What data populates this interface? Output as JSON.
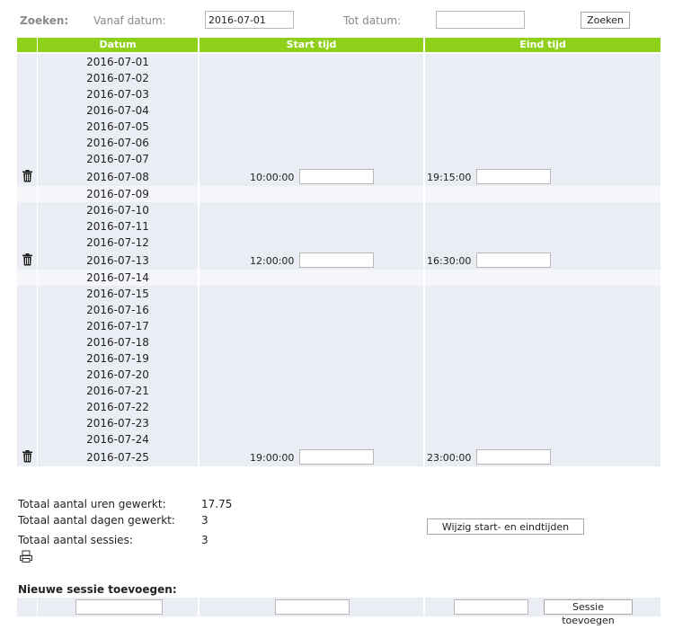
{
  "search": {
    "label": "Zoeken:",
    "from_label": "Vanaf datum:",
    "from_value": "2016-07-01",
    "to_label": "Tot datum:",
    "to_value": "",
    "button": "Zoeken"
  },
  "table": {
    "headers": [
      "Datum",
      "Start tijd",
      "Eind tijd"
    ],
    "rows": [
      {
        "date": "2016-07-01"
      },
      {
        "date": "2016-07-02"
      },
      {
        "date": "2016-07-03"
      },
      {
        "date": "2016-07-04"
      },
      {
        "date": "2016-07-05"
      },
      {
        "date": "2016-07-06"
      },
      {
        "date": "2016-07-07"
      },
      {
        "date": "2016-07-08",
        "start": "10:00:00",
        "end": "19:15:00",
        "session": true
      },
      {
        "date": "2016-07-09"
      },
      {
        "date": "2016-07-10"
      },
      {
        "date": "2016-07-11"
      },
      {
        "date": "2016-07-12"
      },
      {
        "date": "2016-07-13",
        "start": "12:00:00",
        "end": "16:30:00",
        "session": true
      },
      {
        "date": "2016-07-14"
      },
      {
        "date": "2016-07-15"
      },
      {
        "date": "2016-07-16"
      },
      {
        "date": "2016-07-17"
      },
      {
        "date": "2016-07-18"
      },
      {
        "date": "2016-07-19"
      },
      {
        "date": "2016-07-20"
      },
      {
        "date": "2016-07-21"
      },
      {
        "date": "2016-07-22"
      },
      {
        "date": "2016-07-23"
      },
      {
        "date": "2016-07-24"
      },
      {
        "date": "2016-07-25",
        "start": "19:00:00",
        "end": "23:00:00",
        "session": true
      }
    ]
  },
  "summary": {
    "hours_label": "Totaal aantal uren gewerkt:",
    "hours_value": "17.75",
    "days_label": "Totaal aantal dagen gewerkt:",
    "days_value": "3",
    "sessions_label": "Totaal aantal sessies:",
    "sessions_value": "3",
    "edit_button": "Wijzig start- en eindtijden"
  },
  "new_session": {
    "title": "Nieuwe sessie toevoegen:",
    "button": "Sessie toevoegen"
  },
  "colors": {
    "header_green": "#8fd11a",
    "row_grey": "#eaedf3",
    "row_light": "#f4f6fa"
  },
  "icons": {
    "delete": "trash-icon",
    "print": "printer-icon"
  }
}
